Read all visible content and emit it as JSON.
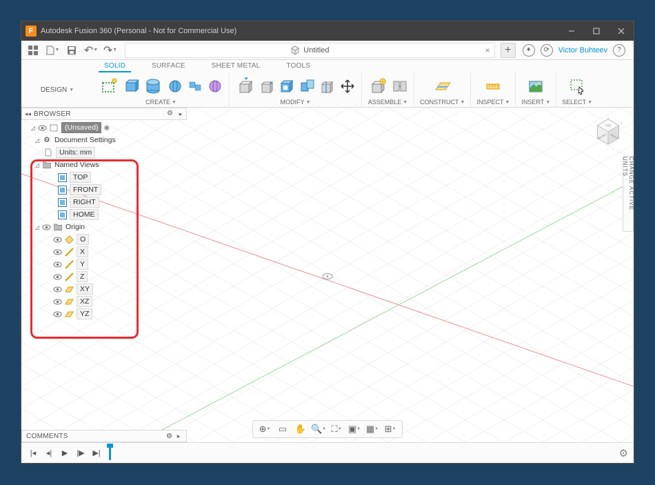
{
  "titlebar": {
    "app_icon": "F",
    "title": "Autodesk Fusion 360 (Personal - Not for Commercial Use)"
  },
  "quickbar": {
    "doc_title": "Untitled",
    "user": "Victor Buhteev"
  },
  "env_tabs": {
    "solid": "SOLID",
    "surface": "SURFACE",
    "sheet_metal": "SHEET METAL",
    "tools": "TOOLS"
  },
  "ribbon": {
    "design": "DESIGN",
    "create": "CREATE",
    "modify": "MODIFY",
    "assemble": "ASSEMBLE",
    "construct": "CONSTRUCT",
    "inspect": "INSPECT",
    "insert": "INSERT",
    "select": "SELECT"
  },
  "browser": {
    "header": "BROWSER",
    "root": "(Unsaved)",
    "doc_settings": "Document Settings",
    "units": "Units: mm",
    "named_views": "Named Views",
    "views": {
      "top": "TOP",
      "front": "FRONT",
      "right": "RIGHT",
      "home": "HOME"
    },
    "origin": "Origin",
    "origin_items": {
      "o": "O",
      "x": "X",
      "y": "Y",
      "z": "Z",
      "xy": "XY",
      "xz": "XZ",
      "yz": "YZ"
    }
  },
  "comments": "COMMENTS",
  "units_tab": "CHANGE ACTIVE UNITS"
}
